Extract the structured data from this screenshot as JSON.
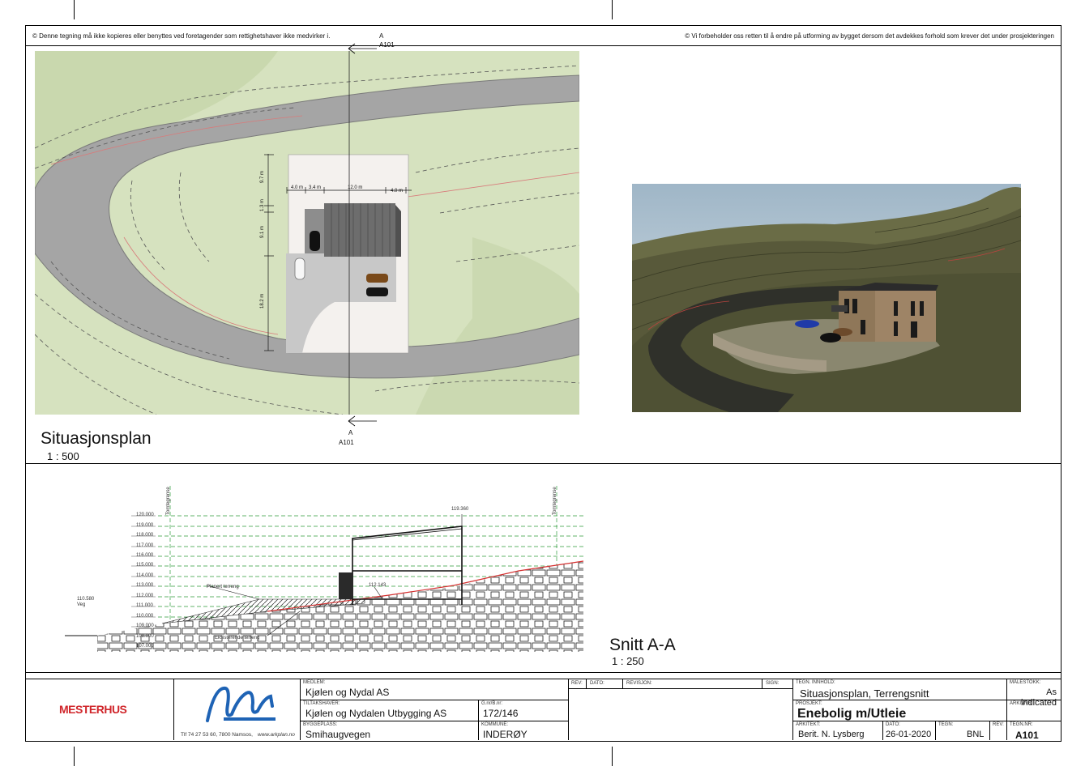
{
  "sheet": {
    "copyright_left": "© Denne tegning må ikke kopieres eller benyttes ved foretagender som rettighetshaver ikke medvirker i.",
    "copyright_right": "© Vi forbeholder oss retten til å endre på utforming av bygget dersom det avdekkes forhold som krever det under prosjekteringen"
  },
  "site_plan": {
    "title": "Situasjonsplan",
    "scale": "1 : 500",
    "section_marker_top": "A",
    "section_marker_top_sheet": "A101",
    "section_marker_bottom": "A",
    "section_marker_bottom_sheet": "A101",
    "dimensions": [
      "4.0 m",
      "3.4 m",
      "12.0 m",
      "4.0 m",
      "9.7 m",
      "1.3 m",
      "9.1 m",
      "18.2 m"
    ]
  },
  "section": {
    "title": "Snitt A-A",
    "scale": "1 : 250",
    "levels": [
      "120.000",
      "119.000",
      "118.000",
      "117.000",
      "116.000",
      "115.000",
      "114.000",
      "113.000",
      "112.000",
      "111.000",
      "110.000",
      "109.000",
      "108.000",
      "107.000"
    ],
    "road_level": "110.580",
    "road_label": "Veg",
    "roof_level": "119.360",
    "floor_level": "112.143",
    "boundary_label_left": "Tomtegrense",
    "boundary_label_right": "Tomtegrense",
    "planned_terrain": "Planert terreng",
    "existing_terrain": "Eksisterende terreng"
  },
  "title_block": {
    "brand": "MESTERHUS",
    "arkplan_contact": "Tlf 74 27 53 60, 7800 Namsos,",
    "arkplan_url": "www.arkplan.no",
    "member_label": "MEDLEM:",
    "member": "Kjølen og Nydal AS",
    "developer_label": "TILTAKSHAVER:",
    "developer": "Kjølen og Nydalen Utbygging AS",
    "gnr_label": "G.nr/B.nr:",
    "gnr": "172/146",
    "site_label": "BYGGEPLASS:",
    "site": "Smihaugvegen",
    "municipality_label": "KOMMUNE:",
    "municipality": "INDERØY",
    "rev_label": "REV:",
    "date_col_label": "DATO:",
    "revision_label": "REVISJON:",
    "sign_label": "SIGN:",
    "content_label": "TEGN. INNHOLD:",
    "content": "Situasjonsplan, Terrengsnitt",
    "project_label": "PROSJEKT:",
    "project": "Enebolig m/Utleie",
    "architect_label": "ARKITEKT:",
    "architect": "Berit. N. Lysberg",
    "date_label": "DATO:",
    "date": "26-01-2020",
    "drawn_label": "TEGN:",
    "drawn": "BNL",
    "rev2_label": "REV:",
    "scale_label": "MÅLESTOKK:",
    "scale_value": "As indicated",
    "archive_label": "ARKIVNR:",
    "sheet_no_label": "TEGN.NR:",
    "sheet_no": "A101"
  }
}
